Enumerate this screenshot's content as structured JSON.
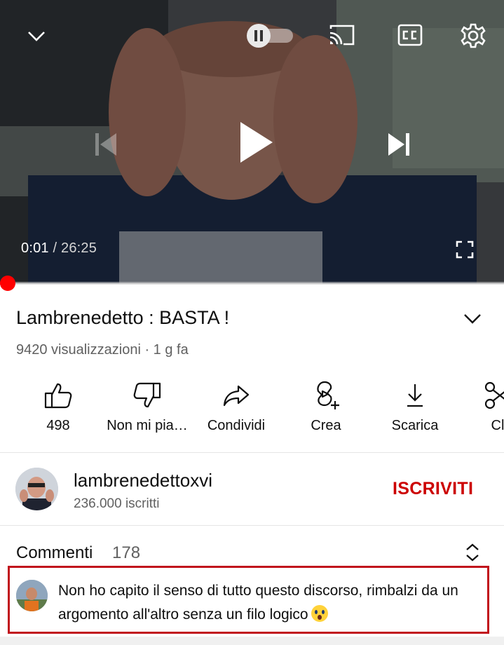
{
  "player": {
    "current_time": "0:01",
    "separator": " / ",
    "duration": "26:25",
    "progress_fraction": 0.0006,
    "icons": [
      "chevron-down-icon",
      "pause-icon",
      "cast-icon",
      "captions-icon",
      "settings-icon",
      "previous-icon",
      "play-icon",
      "next-icon",
      "fullscreen-icon"
    ],
    "accent_color": "#ff0000"
  },
  "video": {
    "title": "Lambrenedetto : BASTA !",
    "meta": "9420 visualizzazioni · 1 g fa"
  },
  "actions": [
    {
      "label": "498",
      "icon": "thumbs-up-icon"
    },
    {
      "label": "Non mi pia…",
      "icon": "thumbs-down-icon"
    },
    {
      "label": "Condividi",
      "icon": "share-icon"
    },
    {
      "label": "Crea",
      "icon": "create-icon"
    },
    {
      "label": "Scarica",
      "icon": "download-icon"
    },
    {
      "label": "Cl",
      "icon": "clip-icon"
    }
  ],
  "channel": {
    "name": "lambrenedettoxvi",
    "subscribers": "236.000 iscritti",
    "subscribe_label": "ISCRIVITI",
    "subscribe_color": "#cc0000"
  },
  "comments": {
    "header": "Commenti",
    "count": "178",
    "top_comment": "Non ho capito il senso di tutto questo discorso, rimbalzi da un argomento all'altro senza un filo logico",
    "highlight_color": "#c1121c"
  }
}
